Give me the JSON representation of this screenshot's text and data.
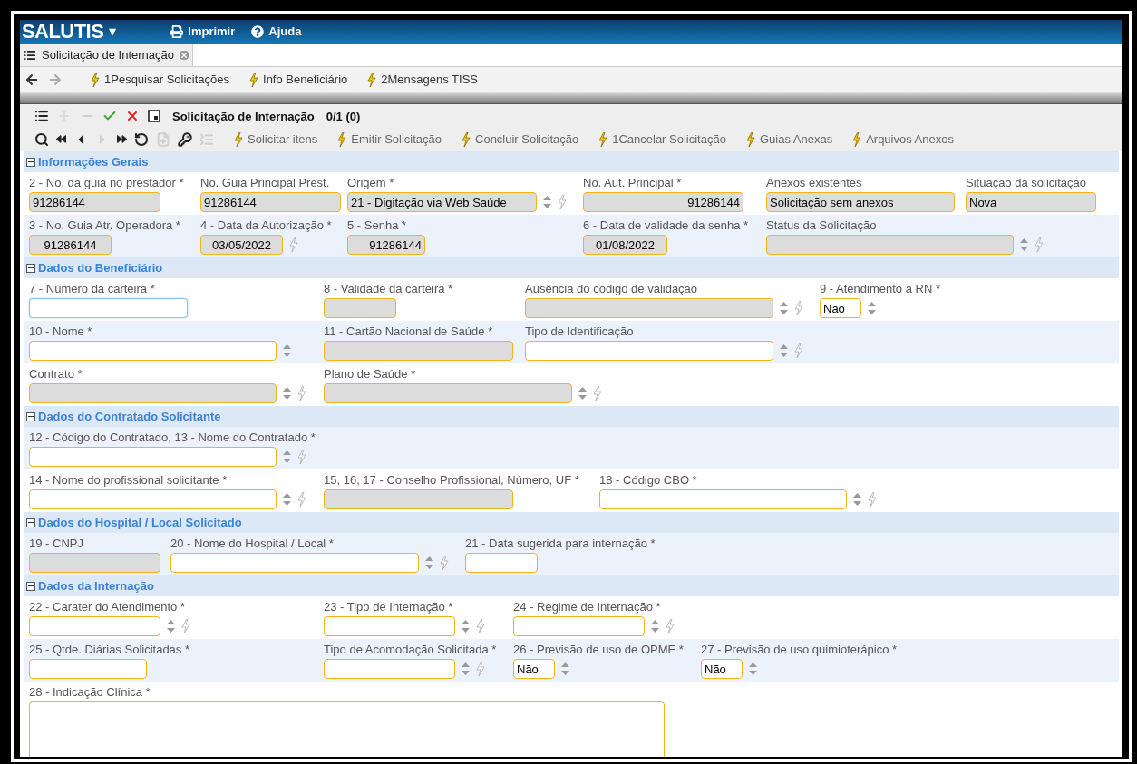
{
  "header": {
    "brand": "SALUTIS",
    "brand_menu": "▾",
    "links": [
      {
        "kind": "print",
        "label": "Imprimir"
      },
      {
        "kind": "help",
        "label": "Ajuda"
      }
    ]
  },
  "tabs": [
    {
      "label": "Solicitação de Internação",
      "selected": true
    }
  ],
  "nav_toolbar": {
    "arrows": [
      {
        "kind": "back",
        "disabled": false
      },
      {
        "kind": "forward",
        "disabled": true
      }
    ],
    "links": [
      "1Pesquisar Solicitações",
      "Info Beneficiário",
      "2Mensagens TISS"
    ]
  },
  "panel": {
    "title": "Solicitação de Internação",
    "counter": "0/1 (0)",
    "record_icons": [
      {
        "kind": "list",
        "disabled": false
      },
      {
        "kind": "add",
        "disabled": true
      },
      {
        "kind": "remove",
        "disabled": true
      },
      {
        "kind": "confirm",
        "disabled": false
      },
      {
        "kind": "cancel",
        "disabled": false
      },
      {
        "kind": "window",
        "disabled": false
      }
    ],
    "nav_icons": [
      {
        "kind": "search",
        "disabled": false
      },
      {
        "kind": "first",
        "disabled": false
      },
      {
        "kind": "prev",
        "disabled": false
      },
      {
        "kind": "next",
        "disabled": true
      },
      {
        "kind": "last",
        "disabled": false
      },
      {
        "kind": "undo",
        "disabled": false
      },
      {
        "kind": "copy",
        "disabled": true
      },
      {
        "kind": "key",
        "disabled": false
      },
      {
        "kind": "details",
        "disabled": true
      }
    ],
    "actions": [
      "Solicitar itens",
      "Emitir Solicitação",
      "Concluir Solicitação",
      "1Cancelar Solicitação",
      "Guias Anexas",
      "Arquivos Anexos"
    ]
  },
  "sections": [
    {
      "title": "Informações Gerais",
      "expanded": true,
      "rows": [
        {
          "fields": [
            {
              "label": "2 - No. da guia no prestador *",
              "value": "91286144",
              "kind": "text",
              "disabled": true,
              "action": false,
              "focused": false
            },
            {
              "label": "No. Guia Principal Prest.",
              "value": "91286144",
              "kind": "text",
              "disabled": true,
              "action": false,
              "focused": false
            },
            {
              "label": "Origem *",
              "value": "21 - Digitação via Web Saúde",
              "kind": "select",
              "disabled": true,
              "action": true,
              "focused": false
            },
            {
              "label": "No. Aut. Principal *",
              "value": "91286144",
              "kind": "text",
              "disabled": true,
              "action": false,
              "focused": false
            },
            {
              "label": "Anexos existentes",
              "value": "Solicitação sem anexos",
              "kind": "text",
              "disabled": true,
              "action": false,
              "focused": false
            },
            {
              "label": "Situação da solicitação",
              "value": "Nova",
              "kind": "text",
              "disabled": true,
              "action": false,
              "focused": false
            }
          ]
        },
        {
          "fields": [
            {
              "label": "3 - No. Guia Atr. Operadora *",
              "value": "91286144",
              "kind": "text",
              "disabled": true,
              "action": false,
              "focused": false
            },
            {
              "label": "4 - Data da Autorização *",
              "value": "03/05/2022",
              "kind": "text",
              "disabled": true,
              "action": true,
              "focused": false
            },
            {
              "label": "5 - Senha *",
              "value": "91286144",
              "kind": "text",
              "disabled": true,
              "action": false,
              "focused": false
            },
            {
              "label": "6 - Data de validade da senha *",
              "value": "01/08/2022",
              "kind": "text",
              "disabled": true,
              "action": false,
              "focused": false
            },
            {
              "label": "Status da Solicitação",
              "kind": "select",
              "disabled": true,
              "action": true,
              "focused": false
            }
          ]
        }
      ]
    },
    {
      "title": "Dados do Beneficiário",
      "expanded": true,
      "rows": [
        {
          "fields": [
            {
              "label": "7 - Número da carteira *",
              "kind": "text",
              "disabled": false,
              "action": false,
              "focused": true
            },
            {
              "label": "8 - Validade da carteira *",
              "kind": "text",
              "disabled": true,
              "action": false,
              "focused": false
            },
            {
              "label": "Ausência do código de validação",
              "kind": "select",
              "disabled": true,
              "action": true,
              "focused": false
            },
            {
              "label": "9 - Atendimento a RN *",
              "value": "Não",
              "kind": "select",
              "disabled": false,
              "action": false,
              "focused": false
            }
          ]
        },
        {
          "fields": [
            {
              "label": "10 - Nome *",
              "kind": "select",
              "disabled": false,
              "action": false,
              "focused": false
            },
            {
              "label": "11 - Cartão Nacional de Saúde *",
              "kind": "text",
              "disabled": true,
              "action": false,
              "focused": false
            },
            {
              "label": "Tipo de Identificação",
              "kind": "select",
              "disabled": false,
              "action": true,
              "focused": false
            }
          ]
        },
        {
          "fields": [
            {
              "label": "Contrato *",
              "kind": "select",
              "disabled": true,
              "action": true,
              "focused": false
            },
            {
              "label": "Plano de Saúde *",
              "kind": "select",
              "disabled": true,
              "action": true,
              "focused": false
            }
          ]
        }
      ]
    },
    {
      "title": "Dados do Contratado Solicitante",
      "expanded": true,
      "rows": [
        {
          "fields": [
            {
              "label": "12 - Código do Contratado, 13 - Nome do Contratado *",
              "kind": "select",
              "disabled": false,
              "action": true,
              "focused": false
            }
          ]
        },
        {
          "fields": [
            {
              "label": "14 - Nome do profissional solicitante *",
              "kind": "select",
              "disabled": false,
              "action": true,
              "focused": false
            },
            {
              "label": "15, 16, 17 - Conselho Profissional, Número, UF *",
              "kind": "text",
              "disabled": true,
              "action": false,
              "focused": false
            },
            {
              "label": "18 - Código CBO *",
              "kind": "select",
              "disabled": false,
              "action": true,
              "focused": false
            }
          ]
        }
      ]
    },
    {
      "title": "Dados do Hospital / Local Solicitado",
      "expanded": true,
      "rows": [
        {
          "fields": [
            {
              "label": "19 - CNPJ",
              "kind": "text",
              "disabled": true,
              "action": false,
              "focused": false
            },
            {
              "label": "20 - Nome do Hospital / Local *",
              "kind": "select",
              "disabled": false,
              "action": true,
              "focused": false
            },
            {
              "label": "21 - Data sugerida para internação *",
              "kind": "text",
              "disabled": false,
              "action": false,
              "focused": false
            }
          ]
        }
      ]
    },
    {
      "title": "Dados da Internação",
      "expanded": true,
      "rows": [
        {
          "fields": [
            {
              "label": "22 - Carater do Atendimento *",
              "kind": "select",
              "disabled": false,
              "action": true,
              "focused": false
            },
            {
              "label": "23 - Tipo de Internação *",
              "kind": "select",
              "disabled": false,
              "action": true,
              "focused": false
            },
            {
              "label": "24 - Regime de Internação *",
              "kind": "select",
              "disabled": false,
              "action": true,
              "focused": false
            }
          ]
        },
        {
          "fields": [
            {
              "label": "25 - Qtde. Diárias Solicitadas *",
              "kind": "text",
              "disabled": false,
              "action": false,
              "focused": false
            },
            {
              "label": "Tipo de Acomodação Solicitada *",
              "kind": "select",
              "disabled": false,
              "action": true,
              "focused": false
            },
            {
              "label": "26 - Previsão de uso de OPME *",
              "value": "Não",
              "kind": "select",
              "disabled": false,
              "action": false,
              "focused": false
            },
            {
              "label": "27 - Previsão de uso quimioterápico *",
              "value": "Não",
              "kind": "select",
              "disabled": false,
              "action": false,
              "focused": false
            }
          ]
        },
        {
          "fields": [
            {
              "label": "28 - Indicação Clínica *",
              "kind": "textarea",
              "disabled": false,
              "action": false,
              "focused": false
            }
          ]
        }
      ]
    }
  ]
}
